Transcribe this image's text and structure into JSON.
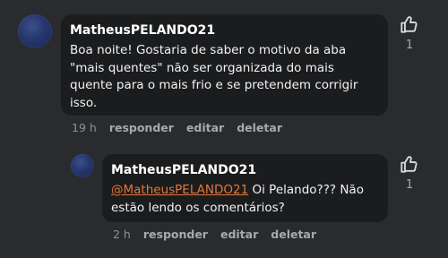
{
  "comments": [
    {
      "author": "MatheusPELANDO21",
      "text": "Boa noite! Gostaria de saber o motivo da aba \"mais quentes\" não ser organizada do mais quente para o mais frio e se pretendem corrigir isso.",
      "time": "19 h",
      "actions": {
        "reply": "responder",
        "edit": "editar",
        "delete": "deletar"
      },
      "likes": "1"
    }
  ],
  "replies": [
    {
      "author": "MatheusPELANDO21",
      "mention": "@MatheusPELANDO21",
      "text": " Oi Pelando??? Não estão lendo os comentários?",
      "time": "2 h",
      "actions": {
        "reply": "responder",
        "edit": "editar",
        "delete": "deletar"
      },
      "likes": "1"
    }
  ],
  "colors": {
    "background": "#2a2b2e",
    "bubble": "#1b1c1e",
    "mention": "#e2773a",
    "muted": "#a7a9ac"
  },
  "icons": {
    "like": "thumbs-up-icon",
    "avatar": "avatar"
  }
}
